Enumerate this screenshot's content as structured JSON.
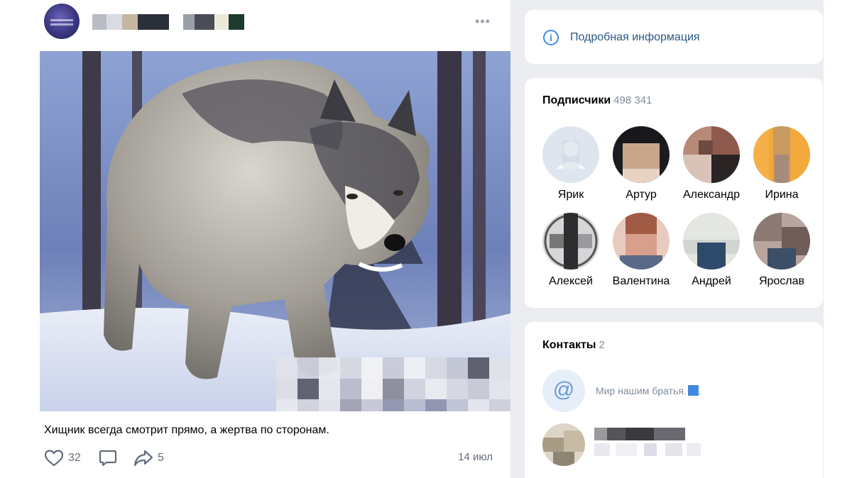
{
  "post": {
    "text": "Хищник всегда смотрит прямо, а жертва по сторонам.",
    "likes": "32",
    "shares": "5",
    "date": "14 июл",
    "more_icon": "more-dots-icon"
  },
  "right": {
    "info_link": "Подробная информация",
    "subscribers": {
      "title": "Подписчики",
      "count": "498 341",
      "people": [
        {
          "name": "Ярик"
        },
        {
          "name": "Артур"
        },
        {
          "name": "Александр"
        },
        {
          "name": "Ирина"
        },
        {
          "name": "Алексей"
        },
        {
          "name": "Валентина"
        },
        {
          "name": "Андрей"
        },
        {
          "name": "Ярослав"
        }
      ]
    },
    "contacts": {
      "title": "Контакты",
      "count": "2",
      "items": [
        {
          "text": "Мир нашим братья."
        },
        {
          "text": ""
        }
      ]
    }
  },
  "colors": {
    "link": "#2a5885",
    "accent": "#3f8ae0",
    "muted": "#818c99",
    "page_bg": "#ebedf0"
  }
}
